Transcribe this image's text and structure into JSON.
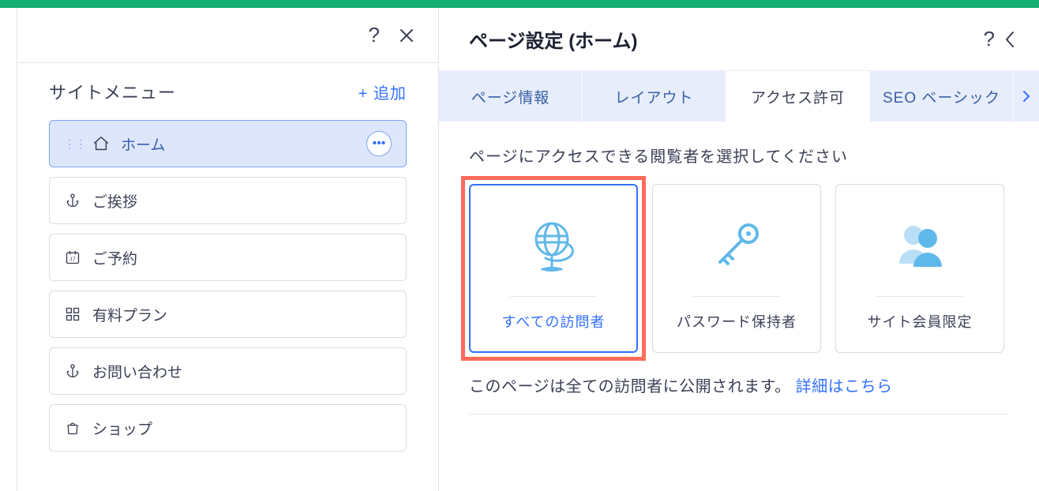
{
  "sidebar": {
    "title": "サイトメニュー",
    "add_label": "+ 追加",
    "items": [
      {
        "label": "ホーム",
        "icon": "home",
        "selected": true
      },
      {
        "label": "ご挨拶",
        "icon": "anchor",
        "selected": false
      },
      {
        "label": "ご予約",
        "icon": "calendar",
        "selected": false
      },
      {
        "label": "有料プラン",
        "icon": "grid",
        "selected": false
      },
      {
        "label": "お問い合わせ",
        "icon": "anchor",
        "selected": false
      },
      {
        "label": "ショップ",
        "icon": "bag",
        "selected": false
      }
    ]
  },
  "settings": {
    "title": "ページ設定 (ホーム)",
    "tabs": [
      {
        "label": "ページ情報",
        "active": false
      },
      {
        "label": "レイアウト",
        "active": false
      },
      {
        "label": "アクセス許可",
        "active": true
      },
      {
        "label": "SEO ベーシック",
        "active": false
      }
    ],
    "content": {
      "prompt": "ページにアクセスできる閲覧者を選択してください",
      "options": [
        {
          "label": "すべての訪問者",
          "icon": "globe",
          "selected": true,
          "highlighted": true
        },
        {
          "label": "パスワード保持者",
          "icon": "key",
          "selected": false,
          "highlighted": false
        },
        {
          "label": "サイト会員限定",
          "icon": "members",
          "selected": false,
          "highlighted": false
        }
      ],
      "footer_text": "このページは全ての訪問者に公開されます。 ",
      "footer_link": "詳細はこちら"
    }
  }
}
